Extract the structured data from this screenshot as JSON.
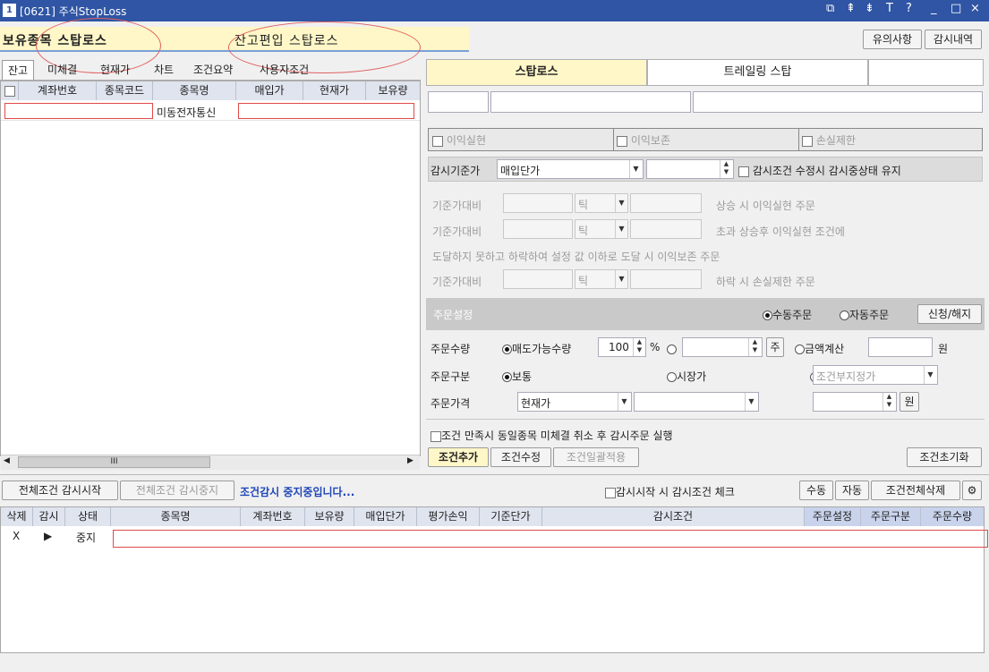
{
  "window": {
    "number": "1",
    "title": "[0621] 주식StopLoss",
    "controls": [
      "⧉",
      "⇞",
      "⇟",
      "T",
      "?",
      "_",
      "□",
      "×"
    ]
  },
  "header": {
    "tab_holding": "보유종목 스탑로스",
    "tab_balance": "잔고편입 스탑로스",
    "btn_notice": "유의사항",
    "btn_history": "감시내역"
  },
  "left_tabs": [
    "잔고",
    "미체결",
    "현재가",
    "차트",
    "조건요약",
    "사용자조건"
  ],
  "grid": {
    "headers": [
      "",
      "계좌번호",
      "종목코드",
      "종목명",
      "매입가",
      "현재가",
      "보유량"
    ],
    "rows": [
      {
        "account": "",
        "code": "",
        "name": "미동전자통신",
        "price": "",
        "current": "",
        "qty": ""
      }
    ]
  },
  "right_tabs": {
    "stoploss": "스탑로스",
    "trailing": "트레일링 스탑"
  },
  "conditions": {
    "profit": "이익실현",
    "protect": "이익보존",
    "loss": "손실제한"
  },
  "monitor": {
    "label": "감시기준가",
    "select_value": "매입단가",
    "keep_label": "감시조건 수정시 감시중상태 유지"
  },
  "ref_rows": {
    "label": "기준가대비",
    "tick": "틱",
    "desc1": "상승 시  이익실현  주문",
    "desc2": "초과 상승후 이익실현 조건에",
    "desc3": "도달하지 못하고 하락하여 설정 값 이하로 도달 시  이익보존 주문",
    "desc4": "하락 시 손실제한 주문"
  },
  "order_settings": {
    "title": "주문설정",
    "manual": "수동주문",
    "auto": "자동주문",
    "btn": "신청/해지"
  },
  "order_qty": {
    "label": "주문수량",
    "opt1": "매도가능수량",
    "value": "100",
    "unit": "%",
    "btn_ju": "주",
    "opt3": "금액계산",
    "won": "원"
  },
  "order_type": {
    "label": "주문구분",
    "opt1": "보통",
    "opt2": "시장가",
    "opt3": "조건부지정가"
  },
  "order_price": {
    "label": "주문가격",
    "opt1": "현재가",
    "won": "원"
  },
  "cancel_check": "조건 만족시 동일종목 미체결 취소 후 감시주문 실행",
  "buttons": {
    "add": "조건추가",
    "edit": "조건수정",
    "batch": "조건일괄적용",
    "reset": "조건초기화"
  },
  "scroll_mark": "III",
  "bottom_bar": {
    "start_all": "전체조건 감시시작",
    "stop_all": "전체조건 감시중지",
    "status": "조건감시 중지중입니다...",
    "check_label": "감시시작 시 감시조건 체크",
    "manual": "수동",
    "auto": "자동",
    "delete_all": "조건전체삭제",
    "gear": "⚙"
  },
  "table2": {
    "headers": [
      "삭제",
      "감시",
      "상태",
      "종목명",
      "계좌번호",
      "보유량",
      "매입단가",
      "평가손익",
      "기준단가",
      "감시조건",
      "주문설정",
      "주문구분",
      "주문수량"
    ],
    "row": {
      "del": "X",
      "play": "▶",
      "state": "중지"
    }
  },
  "colors": {
    "titlebar": "#2f55a4",
    "accent_tab": "#fff7c8",
    "status_text": "#1f47b8",
    "highlight": "#e04a4a"
  }
}
